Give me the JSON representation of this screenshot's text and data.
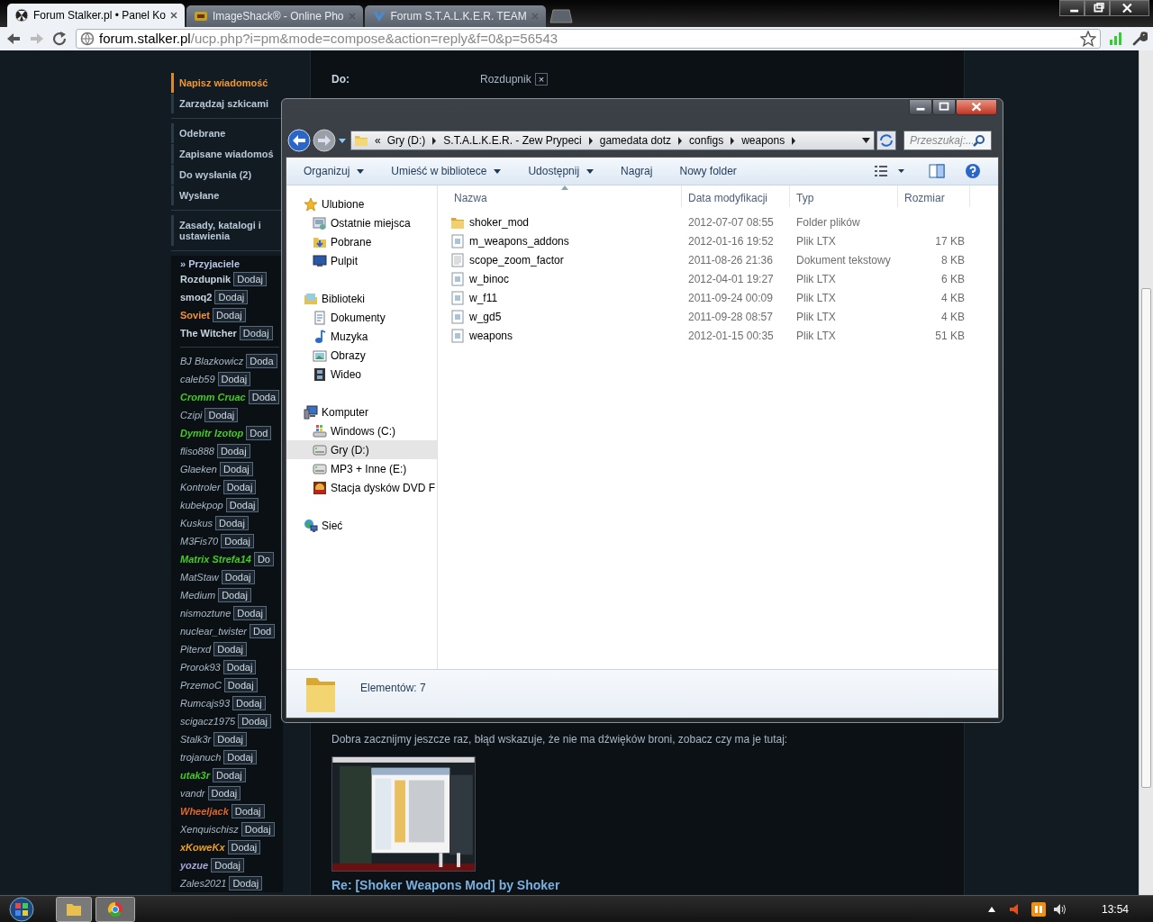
{
  "browser": {
    "tabs": [
      {
        "title": "Forum Stalker.pl • Panel Ko",
        "selected": true
      },
      {
        "title": "ImageShack® - Online Pho",
        "selected": false
      },
      {
        "title": "Forum S.T.A.L.K.E.R. TEAM",
        "selected": false
      }
    ],
    "url_host": "forum.stalker.pl",
    "url_path": "/ucp.php?i=pm&mode=compose&action=reply&f=0&p=56543"
  },
  "forum": {
    "menu": [
      [
        {
          "label": "Napisz wiadomość",
          "selected": true
        },
        {
          "label": "Zarządzaj szkicami",
          "selected": false
        }
      ],
      [
        {
          "label": "Odebrane",
          "selected": false
        },
        {
          "label": "Zapisane wiadomoś",
          "selected": false
        },
        {
          "label": "Do wysłania (2)",
          "selected": false
        },
        {
          "label": "Wysłane",
          "selected": false
        }
      ],
      [
        {
          "label": "Zasady, katalogi i ustawienia",
          "selected": false
        }
      ]
    ],
    "friends_header": "» Przyjaciele",
    "friends_online": [
      {
        "name": "Rozdupnik",
        "color": "#c8d4e0",
        "bold": true,
        "button": "Dodaj"
      },
      {
        "name": "smoq2",
        "color": "#c8d4e0",
        "bold": true,
        "button": "Dodaj"
      },
      {
        "name": "Soviet",
        "color": "#f0903a",
        "bold": true,
        "button": "Dodaj"
      },
      {
        "name": "The Witcher",
        "color": "#c8d4e0",
        "bold": true,
        "button": "Dodaj"
      }
    ],
    "friends_offline": [
      {
        "name": "BJ Blazkowicz",
        "color": "#a9b7c6",
        "bold": false,
        "button": "Doda"
      },
      {
        "name": "caleb59",
        "color": "#a9b7c6",
        "bold": false,
        "button": "Dodaj"
      },
      {
        "name": "Cromm Cruac",
        "color": "#44cc22",
        "bold": true,
        "button": "Doda"
      },
      {
        "name": "Czipi",
        "color": "#a9b7c6",
        "bold": false,
        "button": "Dodaj"
      },
      {
        "name": "Dymitr Izotop",
        "color": "#44cc22",
        "bold": true,
        "button": "Dod"
      },
      {
        "name": "fliso888",
        "color": "#a9b7c6",
        "bold": false,
        "button": "Dodaj"
      },
      {
        "name": "Glaeken",
        "color": "#a9b7c6",
        "bold": false,
        "button": "Dodaj"
      },
      {
        "name": "Kontroler",
        "color": "#a9b7c6",
        "bold": false,
        "button": "Dodaj"
      },
      {
        "name": "kubekpop",
        "color": "#a9b7c6",
        "bold": false,
        "button": "Dodaj"
      },
      {
        "name": "Kuskus",
        "color": "#a9b7c6",
        "bold": false,
        "button": "Dodaj"
      },
      {
        "name": "M3Fis70",
        "color": "#a9b7c6",
        "bold": false,
        "button": "Dodaj"
      },
      {
        "name": "Matrix Strefa14",
        "color": "#44cc22",
        "bold": true,
        "button": "Do"
      },
      {
        "name": "MatStaw",
        "color": "#a9b7c6",
        "bold": false,
        "button": "Dodaj"
      },
      {
        "name": "Medium",
        "color": "#a9b7c6",
        "bold": false,
        "button": "Dodaj"
      },
      {
        "name": "nismoztune",
        "color": "#a9b7c6",
        "bold": false,
        "button": "Dodaj"
      },
      {
        "name": "nuclear_twister",
        "color": "#a9b7c6",
        "bold": false,
        "button": "Dod"
      },
      {
        "name": "Piterxd",
        "color": "#a9b7c6",
        "bold": false,
        "button": "Dodaj"
      },
      {
        "name": "Prorok93",
        "color": "#a9b7c6",
        "bold": false,
        "button": "Dodaj"
      },
      {
        "name": "PrzemoC",
        "color": "#a9b7c6",
        "bold": false,
        "button": "Dodaj"
      },
      {
        "name": "Rumcajs93",
        "color": "#a9b7c6",
        "bold": false,
        "button": "Dodaj"
      },
      {
        "name": "scigacz1975",
        "color": "#a9b7c6",
        "bold": false,
        "button": "Dodaj"
      },
      {
        "name": "Stalk3r",
        "color": "#a9b7c6",
        "bold": false,
        "button": "Dodaj"
      },
      {
        "name": "trojanuch",
        "color": "#a9b7c6",
        "bold": false,
        "button": "Dodaj"
      },
      {
        "name": "utak3r",
        "color": "#44cc22",
        "bold": true,
        "button": "Dodaj"
      },
      {
        "name": "vandr",
        "color": "#a9b7c6",
        "bold": false,
        "button": "Dodaj"
      },
      {
        "name": "Wheeljack",
        "color": "#e0652a",
        "bold": true,
        "button": "Dodaj"
      },
      {
        "name": "Xenquischisz",
        "color": "#a9b7c6",
        "bold": false,
        "button": "Dodaj"
      },
      {
        "name": "xKoweKx",
        "color": "#f0a020",
        "bold": true,
        "button": "Dodaj"
      },
      {
        "name": "yozue",
        "color": "#a8a8d8",
        "bold": true,
        "button": "Dodaj"
      },
      {
        "name": "Zales2021",
        "color": "#a9b7c6",
        "bold": false,
        "button": "Dodaj"
      }
    ],
    "recipient_label": "Do:",
    "recipient": "Rozdupnik",
    "remove_button": "×",
    "post_text": "Dobra zacznijmy jeszcze raz, błąd wskazuje, że nie ma dźwięków broni, zobacz czy ma je tutaj:",
    "post_image": {
      "kind": "picture"
    },
    "next_post_title": "Re: [Shoker Weapons Mod] by Shoker"
  },
  "explorer": {
    "overflow": "«",
    "breadcrumb": [
      "Gry (D:)",
      "S.T.A.L.K.E.R. - Zew Prypeci",
      "gamedata dotz",
      "configs",
      "weapons"
    ],
    "search": {
      "placeholder": "Przeszukaj:..."
    },
    "toolbar": [
      {
        "label": "Organizuj",
        "dropdown": true
      },
      {
        "label": "Umieść w bibliotece",
        "dropdown": true
      },
      {
        "label": "Udostępnij",
        "dropdown": true
      },
      {
        "label": "Nagraj",
        "dropdown": false
      },
      {
        "label": "Nowy folder",
        "dropdown": false
      }
    ],
    "nav": [
      {
        "label": "Ulubione",
        "selected": false,
        "children": [
          {
            "label": "Ostatnie miejsca",
            "selected": false
          },
          {
            "label": "Pobrane",
            "selected": false
          },
          {
            "label": "Pulpit",
            "selected": false
          }
        ]
      },
      {
        "label": "Biblioteki",
        "selected": false,
        "children": [
          {
            "label": "Dokumenty",
            "selected": false
          },
          {
            "label": "Muzyka",
            "selected": false
          },
          {
            "label": "Obrazy",
            "selected": false
          },
          {
            "label": "Wideo",
            "selected": false
          }
        ]
      },
      {
        "label": "Komputer",
        "selected": false,
        "children": [
          {
            "label": "Windows (C:)",
            "selected": false
          },
          {
            "label": "Gry (D:)",
            "selected": true
          },
          {
            "label": "MP3 + Inne (E:)",
            "selected": false
          },
          {
            "label": "Stacja dysków DVD F",
            "selected": false
          }
        ]
      },
      {
        "label": "Sieć",
        "selected": false
      }
    ],
    "columns": [
      "Nazwa",
      "Data modyfikacji",
      "Typ",
      "Rozmiar"
    ],
    "files": [
      {
        "name": "shoker_mod",
        "date": "2012-07-07 08:55",
        "type": "Folder plików",
        "kind": "folder"
      },
      {
        "name": "m_weapons_addons",
        "date": "2012-01-16 19:52",
        "type": "Plik LTX",
        "size": "17 KB",
        "kind": "ltx"
      },
      {
        "name": "scope_zoom_factor",
        "date": "2011-08-26 21:36",
        "type": "Dokument tekstowy",
        "size": "8 KB",
        "kind": "text"
      },
      {
        "name": "w_binoc",
        "date": "2012-04-01 19:27",
        "type": "Plik LTX",
        "size": "6 KB",
        "kind": "ltx"
      },
      {
        "name": "w_f11",
        "date": "2011-09-24 00:09",
        "type": "Plik LTX",
        "size": "4 KB",
        "kind": "ltx"
      },
      {
        "name": "w_gd5",
        "date": "2011-09-28 08:57",
        "type": "Plik LTX",
        "size": "4 KB",
        "kind": "ltx"
      },
      {
        "name": "weapons",
        "date": "2012-01-15 00:35",
        "type": "Plik LTX",
        "size": "51 KB",
        "kind": "ltx"
      }
    ],
    "status": "Elementów: 7"
  },
  "taskbar": {
    "clock": "13:54"
  }
}
